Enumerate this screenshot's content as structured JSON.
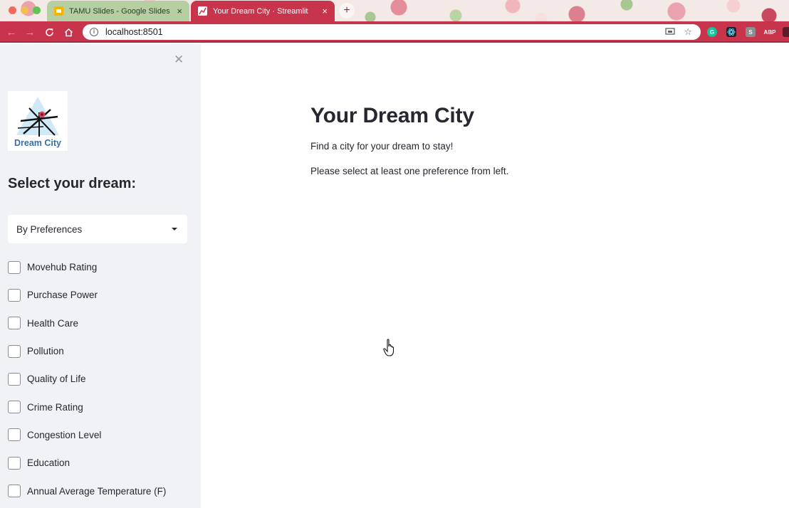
{
  "browser": {
    "tabs": [
      {
        "title": "TAMU Slides - Google Slides",
        "active": false,
        "favicon": "google-slides-icon"
      },
      {
        "title": "Your Dream City · Streamlit",
        "active": true,
        "favicon": "streamlit-icon"
      }
    ],
    "url": "localhost:8501",
    "extensions": [
      "grammarly-icon",
      "react-devtools-icon",
      "s-extension-icon",
      "adblock-plus-icon",
      "puzzle-extension-icon"
    ],
    "ext_labels": {
      "s": "S",
      "abp": "ABP"
    },
    "theme_color": "#c8344c"
  },
  "sidebar": {
    "logo_text": "Dream City",
    "heading": "Select your dream:",
    "select": {
      "value": "By Preferences"
    },
    "preferences": [
      "Movehub Rating",
      "Purchase Power",
      "Health Care",
      "Pollution",
      "Quality of Life",
      "Crime Rating",
      "Congestion Level",
      "Education",
      "Annual Average Temperature (F)"
    ],
    "background": "#f0f2f6"
  },
  "main": {
    "title": "Your Dream City",
    "subtitle": "Find a city for your dream to stay!",
    "instruction": "Please select at least one preference from left."
  }
}
